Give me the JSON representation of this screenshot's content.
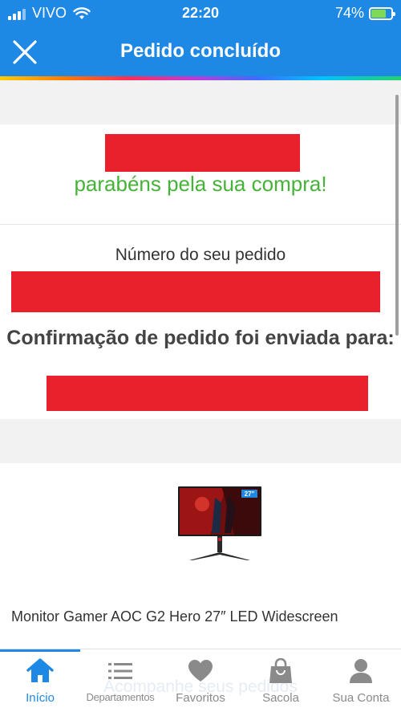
{
  "status_bar": {
    "carrier": "VIVO",
    "time": "22:20",
    "battery_percent": "74%",
    "battery_level": 0.74
  },
  "header": {
    "title": "Pedido concluído",
    "close_icon": "close-icon"
  },
  "confirmation": {
    "congrats_text": "parabéns pela sua compra!",
    "order_number_label": "Número do seu pedido",
    "confirmation_text": "Confirmação de pedido foi enviada para:"
  },
  "product": {
    "name": "Monitor Gamer AOC G2 Hero 27″ LED Widescreen",
    "badge": "27\""
  },
  "tracking": {
    "label": "Acompanhe seus pedidos"
  },
  "bottom_nav": {
    "items": [
      {
        "label": "Início",
        "icon": "home-icon",
        "active": true
      },
      {
        "label": "Departamentos",
        "icon": "menu-icon",
        "active": false
      },
      {
        "label": "Favoritos",
        "icon": "heart-icon",
        "active": false
      },
      {
        "label": "Sacola",
        "icon": "bag-icon",
        "active": false
      },
      {
        "label": "Sua Conta",
        "icon": "user-icon",
        "active": false
      }
    ]
  },
  "colors": {
    "brand_blue": "#1e88e5",
    "success_green": "#45b337",
    "redaction_red": "#e8212d"
  }
}
